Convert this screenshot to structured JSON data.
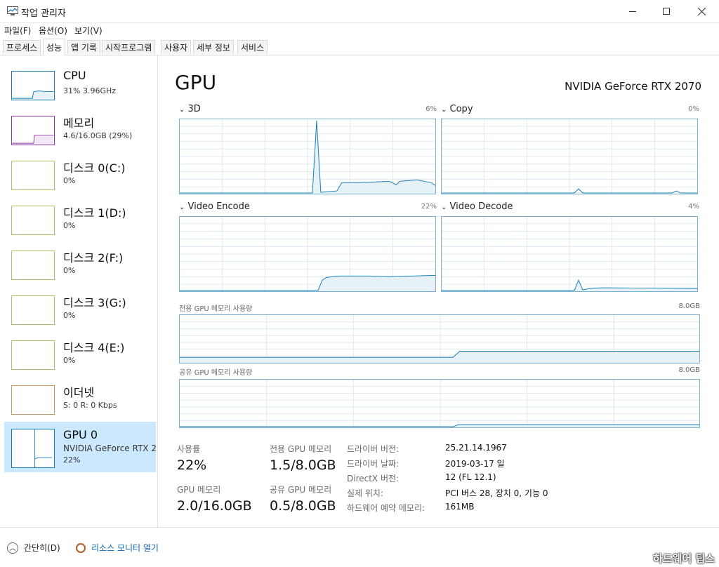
{
  "window": {
    "title": "작업 관리자",
    "min_icon": "minimize-icon",
    "max_icon": "maximize-icon",
    "close_icon": "close-icon"
  },
  "menu": [
    "파일(F)",
    "옵션(O)",
    "보기(V)"
  ],
  "tabs": [
    "프로세스",
    "성능",
    "앱 기록",
    "시작프로그램",
    "사용자",
    "세부 정보",
    "서비스"
  ],
  "active_tab": "성능",
  "sidebar": [
    {
      "title": "CPU",
      "line1": "31% 3.96GHz",
      "line2": "",
      "color": "#1b7fb5"
    },
    {
      "title": "메모리",
      "line1": "4.6/16.0GB (29%)",
      "line2": "",
      "color": "#8b3fa3"
    },
    {
      "title": "디스크 0(C:)",
      "line1": "0%",
      "line2": "",
      "color": "#5c8c1e"
    },
    {
      "title": "디스크 1(D:)",
      "line1": "0%",
      "line2": "",
      "color": "#5c8c1e"
    },
    {
      "title": "디스크 2(F:)",
      "line1": "0%",
      "line2": "",
      "color": "#5c8c1e"
    },
    {
      "title": "디스크 3(G:)",
      "line1": "0%",
      "line2": "",
      "color": "#5c8c1e"
    },
    {
      "title": "디스크 4(E:)",
      "line1": "0%",
      "line2": "",
      "color": "#5c8c1e"
    },
    {
      "title": "이더넷",
      "line1": "S: 0  R: 0 Kbps",
      "line2": "",
      "color": "#a7692a"
    },
    {
      "title": "GPU 0",
      "line1": "NVIDIA GeForce RTX 2",
      "line2": "22%",
      "color": "#1b7fb5"
    }
  ],
  "main": {
    "title": "GPU",
    "gpu_name": "NVIDIA GeForce RTX 2070",
    "graphs": [
      {
        "label": "3D",
        "pct": "6%"
      },
      {
        "label": "Copy",
        "pct": "0%"
      },
      {
        "label": "Video Encode",
        "pct": "22%"
      },
      {
        "label": "Video Decode",
        "pct": "4%"
      }
    ],
    "mem_graphs": [
      {
        "label": "전용 GPU 메모리 사용량",
        "max": "8.0GB"
      },
      {
        "label": "공유 GPU 메모리 사용량",
        "max": "8.0GB"
      }
    ],
    "stats": {
      "usage_label": "사용률",
      "usage_value": "22%",
      "dedicated_label": "전용 GPU 메모리",
      "dedicated_value": "1.5/8.0GB",
      "gpu_mem_label": "GPU 메모리",
      "gpu_mem_value": "2.0/16.0GB",
      "shared_label": "공유 GPU 메모리",
      "shared_value": "0.5/8.0GB"
    },
    "info": [
      {
        "label": "드라이버 버전:",
        "value": "25.21.14.1967"
      },
      {
        "label": "드라이버 날짜:",
        "value": "2019-03-17 일"
      },
      {
        "label": "DirectX 버전:",
        "value": "12 (FL 12.1)"
      },
      {
        "label": "실제 위치:",
        "value": "PCI 버스 28, 장치 0, 기능 0"
      },
      {
        "label": "하드웨어 예약 메모리:",
        "value": "161MB"
      }
    ]
  },
  "footer": {
    "simple": "간단히(D)",
    "monitor": "리소스 모니터 열기"
  },
  "watermark": "하드웨어 팁스",
  "colors": {
    "accent": "#1b7fb5",
    "selected": "#cce8ff",
    "graph_border": "#7fb2cf"
  }
}
